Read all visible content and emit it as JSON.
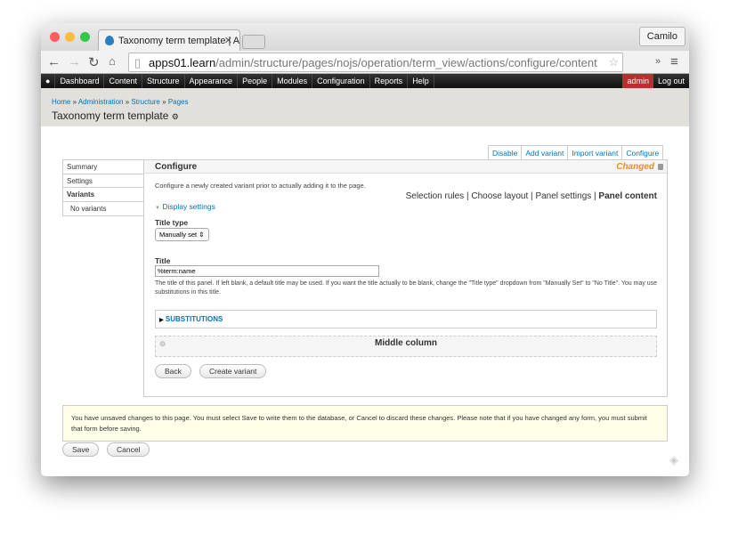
{
  "browser": {
    "tab_title": "Taxonomy term template | A",
    "user": "Camilo",
    "url_host": "apps01.learn",
    "url_path": "/admin/structure/pages/nojs/operation/term_view/actions/configure/content",
    "traffic_lights": [
      "#fc605c",
      "#fdbc40",
      "#34c84a"
    ]
  },
  "admin_menu": {
    "items": [
      "Dashboard",
      "Content",
      "Structure",
      "Appearance",
      "People",
      "Modules",
      "Configuration",
      "Reports",
      "Help"
    ],
    "user": "admin",
    "logout": "Log out",
    "user_color": "#b5302e"
  },
  "header": {
    "breadcrumb": [
      "Home",
      "Administration",
      "Structure",
      "Pages"
    ],
    "title": "Taxonomy term template"
  },
  "operations": [
    "Disable",
    "Add variant",
    "Import variant",
    "Configure"
  ],
  "vertical_tabs": [
    "Summary",
    "Settings",
    "Variants",
    "No variants"
  ],
  "main": {
    "heading": "Configure",
    "status": "Changed",
    "description": "Configure a newly created variant prior to actually adding it to the page.",
    "steps": [
      "Selection rules",
      "Choose layout",
      "Panel settings",
      "Panel content"
    ],
    "display_settings": "Display settings",
    "title_type_label": "Title type",
    "title_type_value": "Manually set",
    "title_label": "Title",
    "title_value": "%term:name",
    "title_help": "The title of this panel. If left blank, a default title may be used. If you want the title actually to be blank, change the \"Title type\" dropdown from \"Manually Set\" to \"No Title\". You may use substitutions in this title.",
    "substitutions": "SUBSTITUTIONS",
    "region": "Middle column",
    "back": "Back",
    "create": "Create variant"
  },
  "message": "You have unsaved changes to this page. You must select Save to write them to the database, or Cancel to discard these changes. Please note that if you have changed any form, you must submit that form before saving.",
  "footer": {
    "save": "Save",
    "cancel": "Cancel"
  }
}
